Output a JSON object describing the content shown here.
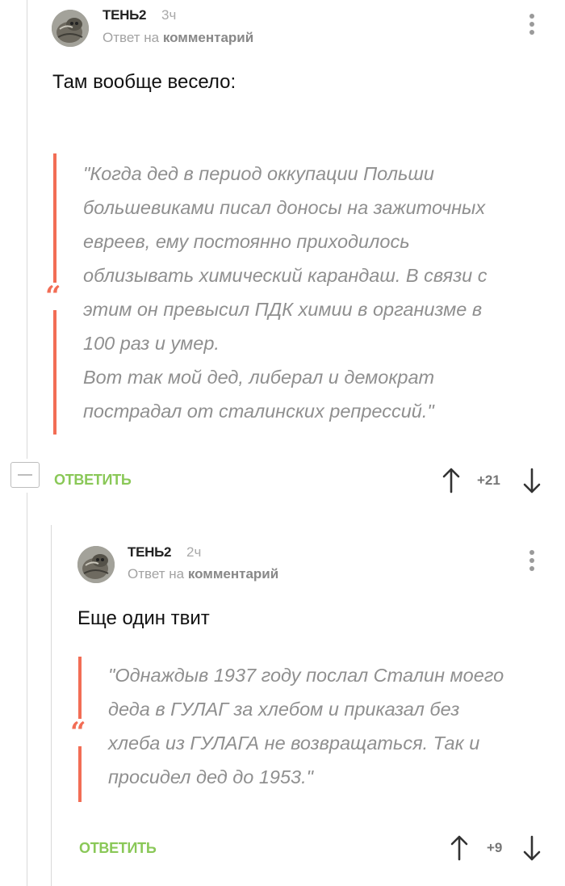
{
  "comments": [
    {
      "author": "ТЕНЬ2",
      "time": "3ч",
      "reply_prefix": "Ответ на",
      "reply_target": "комментарий",
      "text": "Там вообще весело:",
      "quote": "\"Когда дед в период оккупации Польши\nбольшевиками писал доносы на зажиточных\nевреев, ему постоянно приходилось\nоблизывать химический карандаш. В связи с\nэтим он превысил ПДК химии в организме в\n100 раз и умер.\nВот так мой дед, либерал и демократ\nпострадал от сталинских репрессий.\"",
      "reply_label": "ОТВЕТИТЬ",
      "rating": "+21"
    },
    {
      "author": "ТЕНЬ2",
      "time": "2ч",
      "reply_prefix": "Ответ на",
      "reply_target": "комментарий",
      "text": "Еще один твит",
      "quote": "\"Однаждыв 1937 году послал Сталин моего\nдеда в ГУЛАГ за хлебом и приказал без\nхлеба из ГУЛАГА не возвращаться. Так и\nпросидел дед до 1953.\"",
      "reply_label": "ОТВЕТИТЬ",
      "rating": "+9"
    }
  ],
  "icons": {
    "quote": "“",
    "menu": "more-vertical-icon",
    "up": "arrow-up-icon",
    "down": "arrow-down-icon",
    "collapse": "minus-icon"
  },
  "colors": {
    "accent_reply": "#8ac858",
    "quote_bar": "#f26d55",
    "muted": "#a9a9a9"
  }
}
